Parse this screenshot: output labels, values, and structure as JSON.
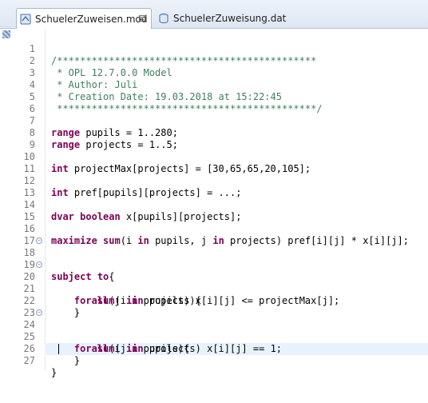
{
  "tabs": [
    {
      "label": "SchuelerZuweisen.mod",
      "icon": "model-file-icon",
      "active": true
    },
    {
      "label": "SchuelerZuweisung.dat",
      "icon": "data-file-icon",
      "active": false
    }
  ],
  "editor": {
    "lines": [
      {
        "n": "1",
        "text": "/*********************************************"
      },
      {
        "n": "2",
        "text": " * OPL 12.7.0.0 Model"
      },
      {
        "n": "3",
        "text": " * Author: Juli"
      },
      {
        "n": "4",
        "text": " * Creation Date: 19.03.2018 at 15:22:45"
      },
      {
        "n": "5",
        "text": " *********************************************/"
      },
      {
        "n": "6",
        "text": ""
      },
      {
        "n": "7",
        "text": "range pupils = 1..280;"
      },
      {
        "n": "8",
        "text": "range projects = 1..5;"
      },
      {
        "n": "9",
        "text": ""
      },
      {
        "n": "10",
        "text": "int projectMax[projects] = [30,65,65,20,105];"
      },
      {
        "n": "11",
        "text": ""
      },
      {
        "n": "12",
        "text": "int pref[pupils][projects] = ...;"
      },
      {
        "n": "13",
        "text": ""
      },
      {
        "n": "14",
        "text": "dvar boolean x[pupils][projects];"
      },
      {
        "n": "15",
        "text": ""
      },
      {
        "n": "16",
        "text": "maximize sum(i in pupils, j in projects) pref[i][j] * x[i][j];"
      },
      {
        "n": "17",
        "text": ""
      },
      {
        "n": "18",
        "text": "subject to{"
      },
      {
        "n": "19",
        "text": ""
      },
      {
        "n": "20",
        "text": "    forall(j in projects){"
      },
      {
        "n": "21",
        "text": "        sum(i in pupils) x[i][j] <= projectMax[j];"
      },
      {
        "n": "22",
        "text": "    }"
      },
      {
        "n": "23",
        "text": ""
      },
      {
        "n": "24",
        "text": "    forall(i in pupils){"
      },
      {
        "n": "25",
        "text": "        sum(j in projects) x[i][j] == 1;"
      },
      {
        "n": "26",
        "text": "    }"
      },
      {
        "n": "27",
        "text": "}"
      }
    ]
  },
  "colors": {
    "comment": "#3f7f5f",
    "keyword": "#7f0055",
    "line_number": "#787878",
    "current_line": "#e8f2fe"
  }
}
